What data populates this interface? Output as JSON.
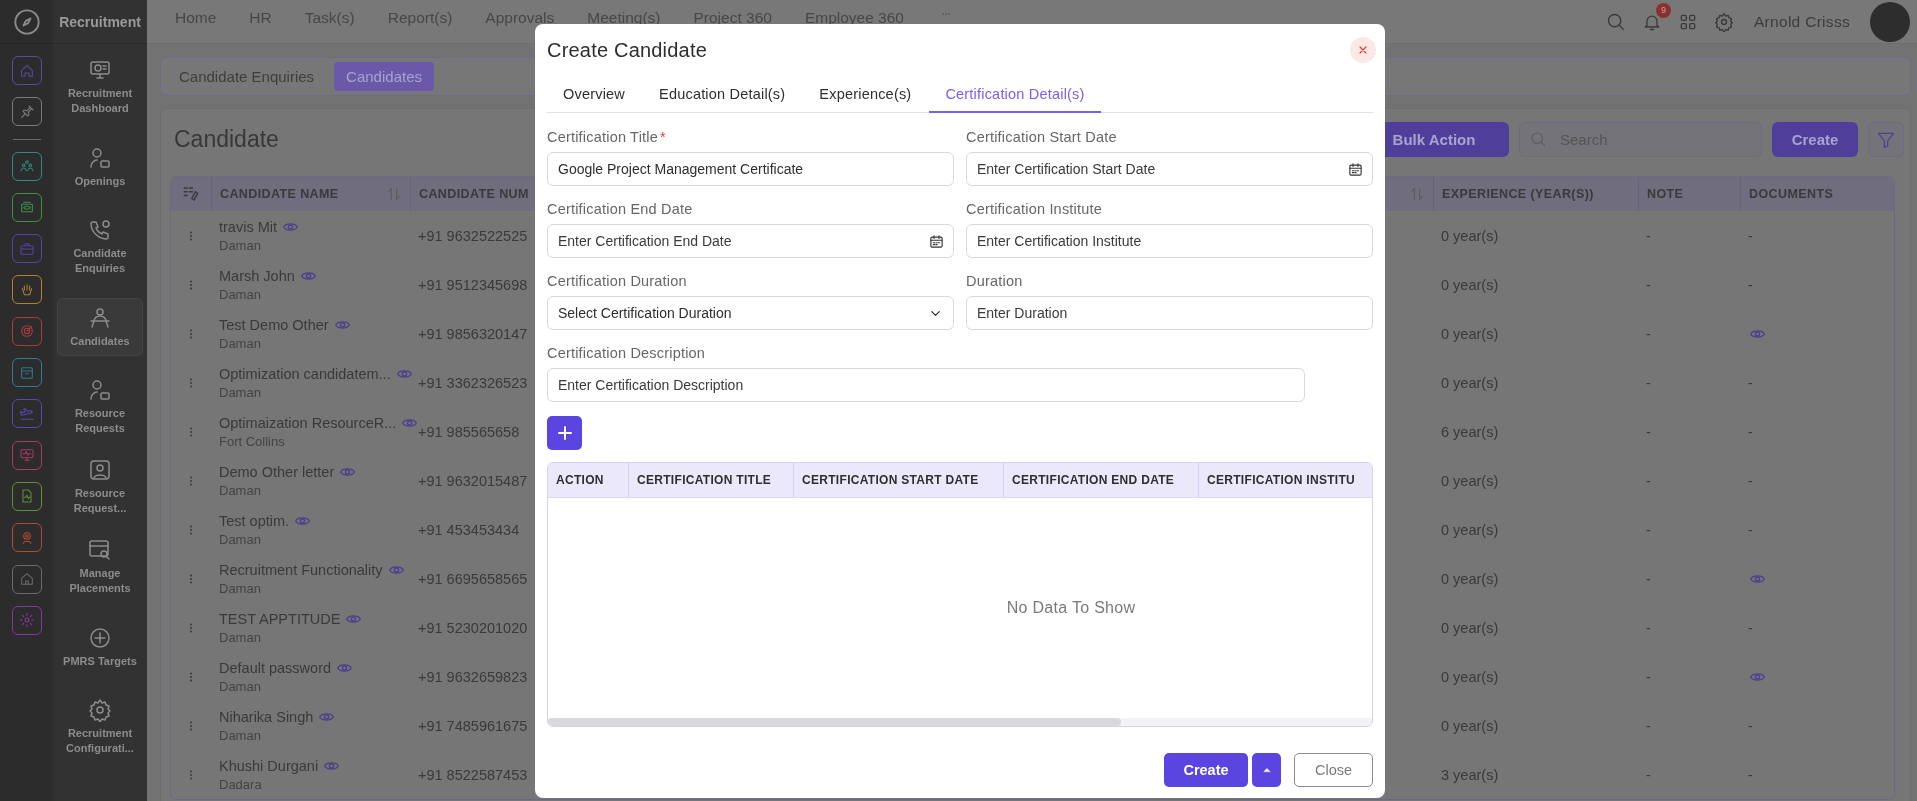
{
  "app": {
    "title": "Recruitment"
  },
  "rail_items": [
    {
      "color": "#5a4aa0"
    },
    {
      "color": "#7a7a7a"
    },
    {
      "color": "#2f8a80"
    },
    {
      "color": "#3f8f45"
    },
    {
      "color": "#5a3fa8"
    },
    {
      "color": "#b08030"
    },
    {
      "color": "#b03a3a"
    },
    {
      "color": "#2f7a95"
    },
    {
      "color": "#5a48b0"
    },
    {
      "color": "#a83a65"
    },
    {
      "color": "#5f8f35"
    },
    {
      "color": "#b04a35"
    },
    {
      "color": "#6a6a6a"
    },
    {
      "color": "#8a35a0"
    }
  ],
  "nav_items": [
    {
      "label": "Recruitment Dashboard",
      "selected": false
    },
    {
      "label": "Openings",
      "selected": false
    },
    {
      "label": "Candidate Enquiries",
      "selected": false
    },
    {
      "label": "Candidates",
      "selected": true
    },
    {
      "label": "Resource Requests",
      "selected": false
    },
    {
      "label": "Resource Request...",
      "selected": false
    },
    {
      "label": "Manage Placements",
      "selected": false
    },
    {
      "label": "PMRS Targets",
      "selected": false
    },
    {
      "label": "Recruitment Configurati...",
      "selected": false
    }
  ],
  "top_menu": [
    "Home",
    "HR",
    "Task(s)",
    "Report(s)",
    "Approvals",
    "Meeting(s)",
    "Project 360",
    "Employee 360"
  ],
  "user": {
    "name": "Arnold Crisss",
    "notification_count": "9"
  },
  "page_tabs": [
    {
      "label": "Candidate Enquiries",
      "selected": false
    },
    {
      "label": "Candidates",
      "selected": true
    }
  ],
  "candidates": {
    "title": "Candidate",
    "bulk_action": "Bulk Action",
    "search_placeholder": "Search",
    "create": "Create",
    "columns": [
      "CANDIDATE NAME",
      "CANDIDATE NUM",
      "EXPERIENCE (YEAR(S))",
      "NOTE",
      "DOCUMENTS"
    ],
    "rows": [
      {
        "name": "travis Mit",
        "location": "Daman",
        "phone": "+91 9632522525",
        "experience": "0 year(s)",
        "note": "-",
        "documents": {
          "kind": "dash",
          "text": "-"
        }
      },
      {
        "name": "Marsh John",
        "location": "Daman",
        "phone": "+91 9512345698",
        "experience": "0 year(s)",
        "note": "-",
        "documents": {
          "kind": "dash",
          "text": "-"
        }
      },
      {
        "name": "Test Demo Other",
        "location": "Daman",
        "phone": "+91 9856320147",
        "experience": "0 year(s)",
        "note": "-",
        "documents": {
          "kind": "view"
        }
      },
      {
        "name": "Optimization candidatem...",
        "location": "Daman",
        "phone": "+91 3362326523",
        "experience": "0 year(s)",
        "note": "-",
        "documents": {
          "kind": "dash",
          "text": "-"
        }
      },
      {
        "name": "Optimaization ResourceR...",
        "location": "Fort Collins",
        "phone": "+91 985565658",
        "experience": "6 year(s)",
        "note": "-",
        "documents": {
          "kind": "dash",
          "text": "-"
        }
      },
      {
        "name": "Demo Other letter",
        "location": "Daman",
        "phone": "+91 9632015487",
        "experience": "0 year(s)",
        "note": "-",
        "documents": {
          "kind": "dash",
          "text": "-"
        }
      },
      {
        "name": "Test optim.",
        "location": "Daman",
        "phone": "+91 453453434",
        "experience": "0 year(s)",
        "note": "-",
        "documents": {
          "kind": "dash",
          "text": "-"
        }
      },
      {
        "name": "Recruitment Functionality",
        "location": "Daman",
        "phone": "+91 6695658565",
        "experience": "0 year(s)",
        "note": "-",
        "documents": {
          "kind": "view"
        }
      },
      {
        "name": "TEST APPTITUDE",
        "location": "Daman",
        "phone": "+91 5230201020",
        "experience": "0 year(s)",
        "note": "-",
        "documents": {
          "kind": "dash",
          "text": "-"
        }
      },
      {
        "name": "Default password",
        "location": "Daman",
        "phone": "+91 9632659823",
        "experience": "0 year(s)",
        "note": "-",
        "documents": {
          "kind": "view"
        }
      },
      {
        "name": "Niharika Singh",
        "location": "Daman",
        "phone": "+91 7485961675",
        "experience": "0 year(s)",
        "note": "-",
        "documents": {
          "kind": "dash",
          "text": "-"
        }
      },
      {
        "name": "Khushi Durgani",
        "location": "Dadara",
        "phone": "+91 8522587453",
        "experience": "3 year(s)",
        "note": "-",
        "documents": {
          "kind": "dash",
          "text": "-"
        }
      }
    ]
  },
  "modal": {
    "title": "Create Candidate",
    "tabs": [
      {
        "label": "Overview",
        "selected": false
      },
      {
        "label": "Education Detail(s)",
        "selected": false
      },
      {
        "label": "Experience(s)",
        "selected": false
      },
      {
        "label": "Certification Detail(s)",
        "selected": true
      }
    ],
    "fields": [
      {
        "kind": "text",
        "label": "Certification Title",
        "required_mark": "*",
        "value": "Google Project Management Certificate"
      },
      {
        "kind": "date",
        "label": "Certification Start Date",
        "placeholder": "Enter Certification Start Date"
      },
      {
        "kind": "date",
        "label": "Certification End Date",
        "placeholder": "Enter Certification End Date"
      },
      {
        "kind": "text",
        "label": "Certification Institute",
        "placeholder": "Enter Certification Institute"
      },
      {
        "kind": "select",
        "label": "Certification Duration",
        "placeholder": "Select Certification Duration"
      },
      {
        "kind": "text",
        "label": "Duration",
        "placeholder": "Enter Duration"
      },
      {
        "kind": "wide",
        "label": "Certification Description",
        "placeholder": "Enter Certification Description"
      }
    ],
    "table": {
      "columns": [
        "ACTION",
        "CERTIFICATION TITLE",
        "CERTIFICATION START DATE",
        "CERTIFICATION END DATE",
        "CERTIFICATION INSTITU"
      ],
      "empty_message": "No Data To Show"
    },
    "create": "Create",
    "close": "Close"
  }
}
